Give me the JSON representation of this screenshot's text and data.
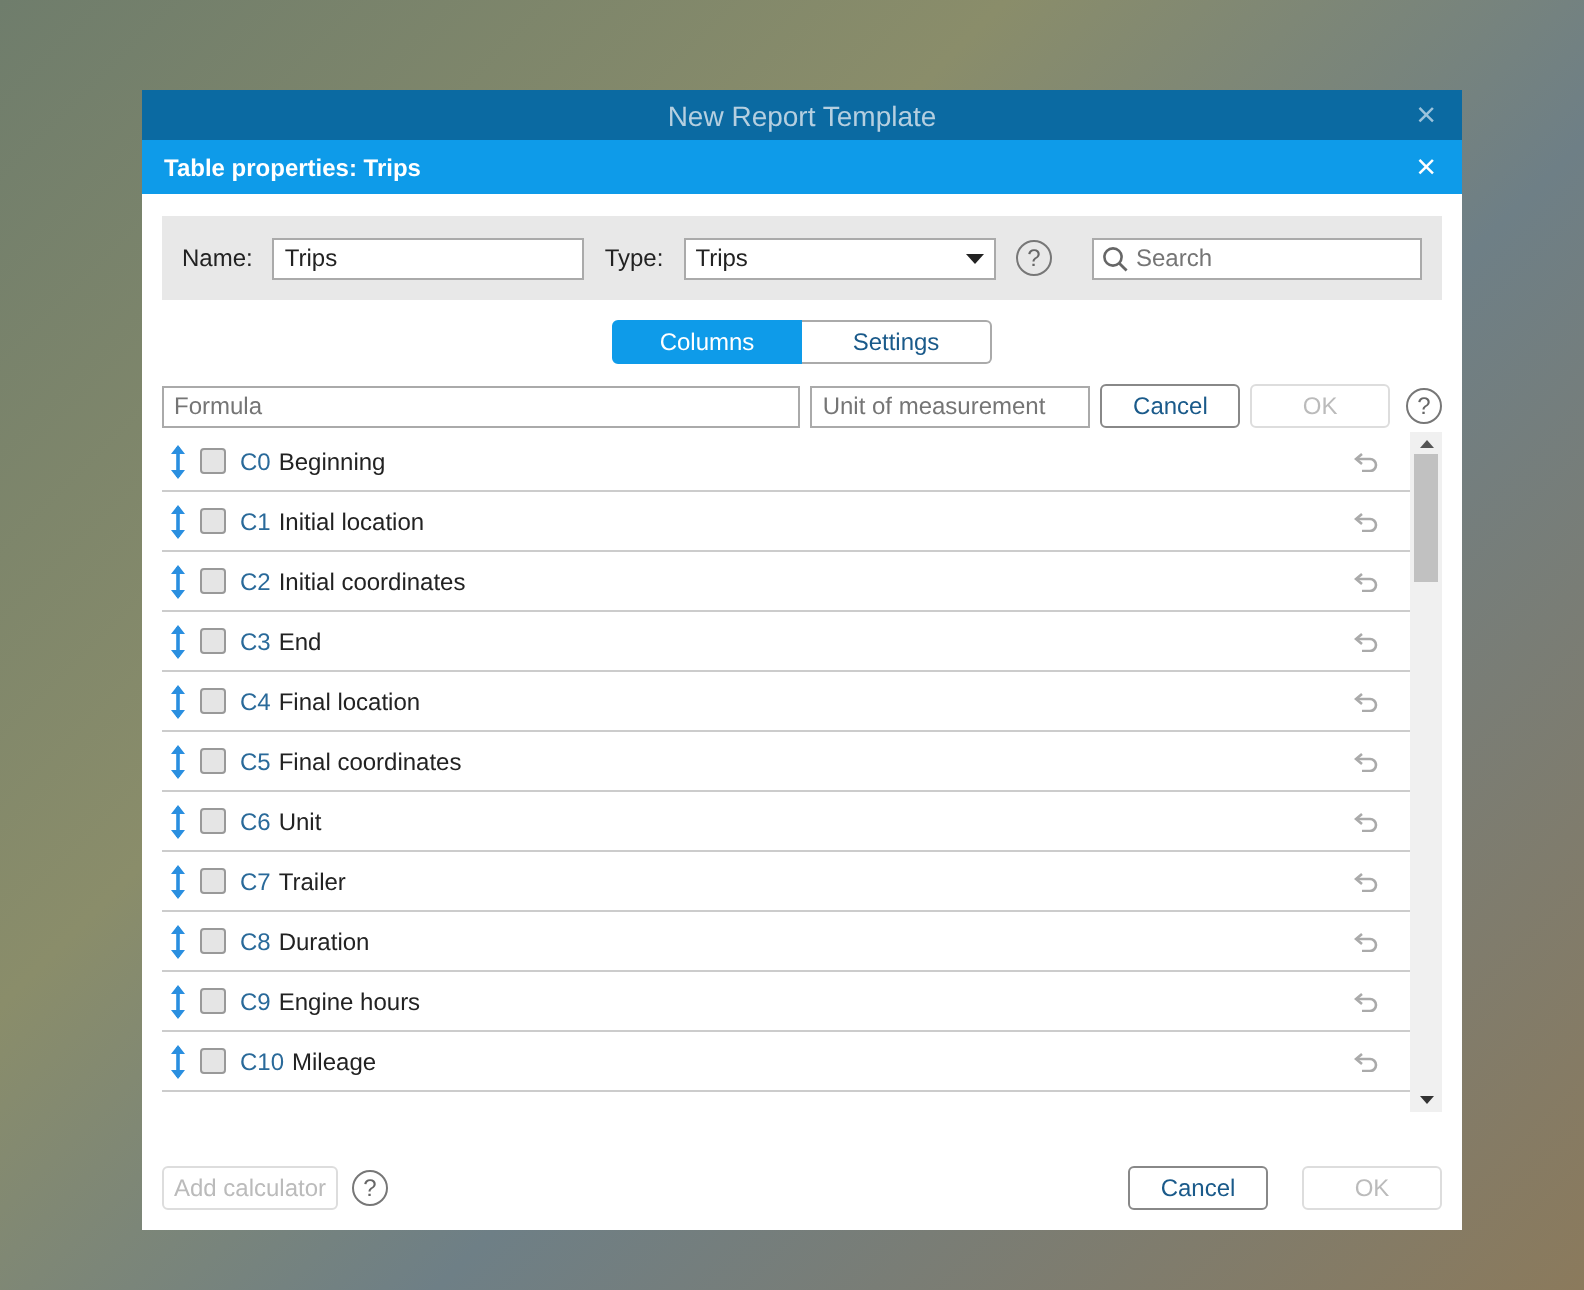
{
  "outer_window": {
    "title": "New Report Template",
    "close": "×"
  },
  "dialog": {
    "title": "Table properties: Trips",
    "close": "×"
  },
  "filter_bar": {
    "name_label": "Name:",
    "name_value": "Trips",
    "type_label": "Type:",
    "type_value": "Trips",
    "help": "?",
    "search": {
      "placeholder": "Search"
    }
  },
  "tabs": [
    {
      "label": "Columns",
      "selected": true
    },
    {
      "label": "Settings",
      "selected": false
    }
  ],
  "formula_bar": {
    "formula": {
      "placeholder": "Formula"
    },
    "unit": {
      "placeholder": "Unit of measurement"
    },
    "buttons": [
      {
        "label": "Cancel",
        "disabled": false
      },
      {
        "label": "OK",
        "disabled": true
      }
    ],
    "help": "?"
  },
  "columns": [
    {
      "code": "C0",
      "name": "Beginning",
      "checked": false
    },
    {
      "code": "C1",
      "name": "Initial location",
      "checked": false
    },
    {
      "code": "C2",
      "name": "Initial coordinates",
      "checked": false
    },
    {
      "code": "C3",
      "name": "End",
      "checked": false
    },
    {
      "code": "C4",
      "name": "Final location",
      "checked": false
    },
    {
      "code": "C5",
      "name": "Final coordinates",
      "checked": false
    },
    {
      "code": "C6",
      "name": "Unit",
      "checked": false
    },
    {
      "code": "C7",
      "name": "Trailer",
      "checked": false
    },
    {
      "code": "C8",
      "name": "Duration",
      "checked": false
    },
    {
      "code": "C9",
      "name": "Engine hours",
      "checked": false
    },
    {
      "code": "C10",
      "name": "Mileage",
      "checked": false
    }
  ],
  "footer": {
    "add_calculator": {
      "label": "Add calculator",
      "disabled": true
    },
    "help": "?",
    "buttons": [
      {
        "label": "Cancel",
        "disabled": false
      },
      {
        "label": "OK",
        "disabled": true
      }
    ]
  }
}
